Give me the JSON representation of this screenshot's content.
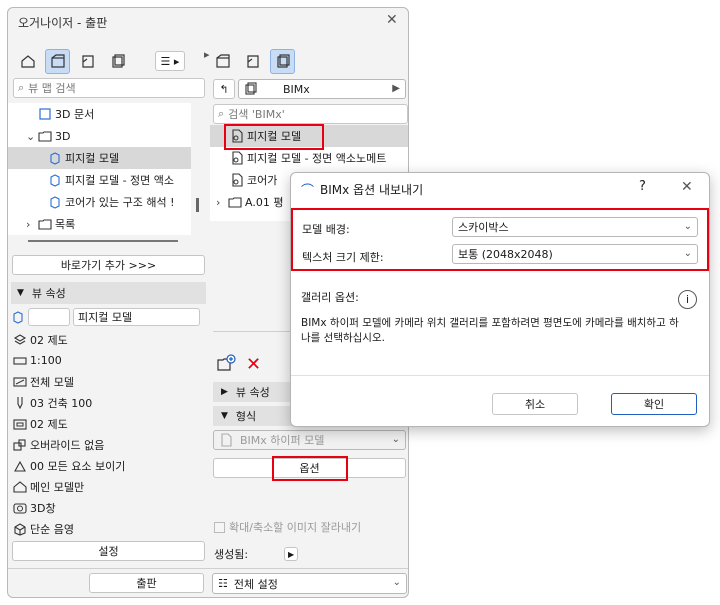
{
  "window": {
    "title": "오거나이저 - 출판"
  },
  "left_panel": {
    "search_placeholder": "뷰 맵 검색",
    "tree": [
      {
        "label": "3D 문서"
      },
      {
        "label": "3D"
      },
      {
        "label": "피지컬 모델"
      },
      {
        "label": "피지컬 모델 - 정면 액소"
      },
      {
        "label": "코어가 있는 구조 해석 !"
      },
      {
        "label": "목록"
      }
    ],
    "add_shortcut_label": "바로가기 추가 >>>",
    "view_props_header": "뷰 속성",
    "view_name_value": "피지컬 모델",
    "properties": [
      {
        "label": "02 제도"
      },
      {
        "label": "1:100"
      },
      {
        "label": "전체 모델"
      },
      {
        "label": "03 건축 100"
      },
      {
        "label": "02 제도"
      },
      {
        "label": "오버라이드 없음"
      },
      {
        "label": "00 모든 요소 보이기"
      },
      {
        "label": "메인 모델만"
      },
      {
        "label": "3D창"
      },
      {
        "label": "단순 음영"
      }
    ],
    "settings_label": "설정",
    "publish_label": "출판"
  },
  "right_panel": {
    "set_dropdown": "BIMx",
    "search_placeholder": "검색 'BIMx'",
    "tree": [
      {
        "label": "피지컬 모델"
      },
      {
        "label": "피지컬 모델 - 정면 액소노메트"
      },
      {
        "label": "코어가"
      },
      {
        "label": "A.01 평"
      }
    ],
    "view_props_header": "뷰 속성",
    "format_header": "형식",
    "format_value": "BIMx 하이퍼 모델",
    "options_label": "옵션",
    "crop_label": "확대/축소할 이미지 잘라내기",
    "generate_label": "생성됨:",
    "all_settings_label": "전체 설정"
  },
  "dialog": {
    "title": "BIMx 옵션 내보내기",
    "help": "?",
    "model_bg_label": "모델 배경:",
    "model_bg_value": "스카이박스",
    "texture_label": "텍스처 크기 제한:",
    "texture_value": "보통 (2048x2048)",
    "gallery_label": "갤러리 옵션:",
    "info_text": "BIMx 하이퍼 모델에 카메라 위치 갤러리를 포함하려면 평면도에 카메라를 배치하고 하나를 선택하십시오.",
    "cancel_label": "취소",
    "ok_label": "확인"
  },
  "colors": {
    "highlight_red": "#e60012",
    "selection_blue": "#c9dcf5",
    "accent_blue": "#1f5fbf"
  }
}
